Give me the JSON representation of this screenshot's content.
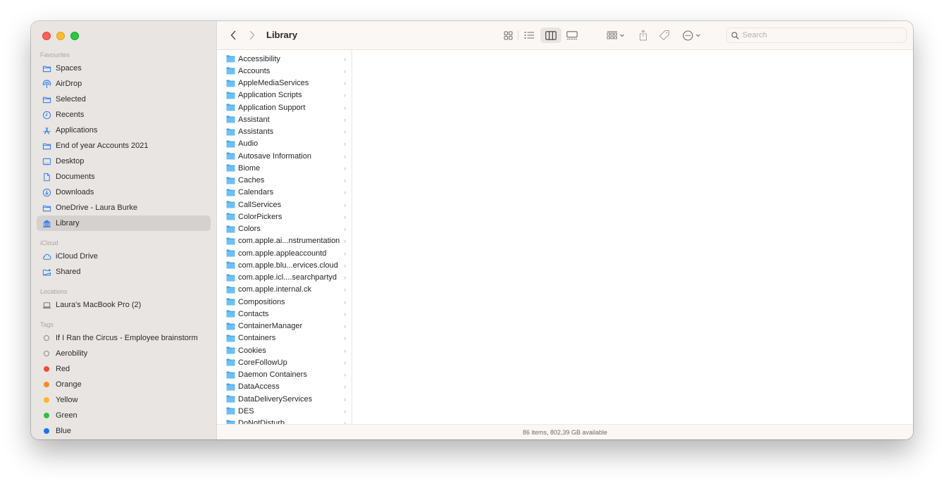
{
  "window": {
    "title": "Library"
  },
  "sidebar": {
    "sections": [
      {
        "label": "Favourites",
        "items": [
          {
            "label": "Spaces",
            "icon": "folder-icon"
          },
          {
            "label": "AirDrop",
            "icon": "airdrop-icon"
          },
          {
            "label": "Selected",
            "icon": "folder-icon"
          },
          {
            "label": "Recents",
            "icon": "clock-icon"
          },
          {
            "label": "Applications",
            "icon": "applications-icon"
          },
          {
            "label": "End of year Accounts 2021",
            "icon": "folder-icon"
          },
          {
            "label": "Desktop",
            "icon": "desktop-icon"
          },
          {
            "label": "Documents",
            "icon": "document-icon"
          },
          {
            "label": "Downloads",
            "icon": "download-icon"
          },
          {
            "label": "OneDrive - Laura Burke",
            "icon": "folder-icon"
          },
          {
            "label": "Library",
            "icon": "library-icon",
            "selected": true
          }
        ]
      },
      {
        "label": "iCloud",
        "items": [
          {
            "label": "iCloud Drive",
            "icon": "cloud-icon"
          },
          {
            "label": "Shared",
            "icon": "shared-folder-icon"
          }
        ]
      },
      {
        "label": "Locations",
        "items": [
          {
            "label": "Laura's MacBook Pro (2)",
            "icon": "laptop-icon"
          }
        ]
      },
      {
        "label": "Tags",
        "items": [
          {
            "label": "If I Ran the Circus - Employee brainstorm",
            "color": ""
          },
          {
            "label": "Aerobility",
            "color": ""
          },
          {
            "label": "Red",
            "color": "#f5483f"
          },
          {
            "label": "Orange",
            "color": "#f78b2c"
          },
          {
            "label": "Yellow",
            "color": "#fbb827"
          },
          {
            "label": "Green",
            "color": "#2cc23e"
          },
          {
            "label": "Blue",
            "color": "#1a73f0"
          }
        ]
      }
    ]
  },
  "toolbar": {
    "back_icon": "chevron-left-icon",
    "forward_icon": "chevron-right-icon",
    "view_modes": [
      "icon-view",
      "list-view",
      "column-view",
      "gallery-view"
    ],
    "active_view": "column-view",
    "group_icon": "group-icon",
    "share_icon": "share-icon",
    "tag_icon": "tag-icon",
    "more_icon": "ellipsis-circle-icon",
    "search_placeholder": "Search",
    "search_value": ""
  },
  "column": {
    "items": [
      "Accessibility",
      "Accounts",
      "AppleMediaServices",
      "Application Scripts",
      "Application Support",
      "Assistant",
      "Assistants",
      "Audio",
      "Autosave Information",
      "Biome",
      "Caches",
      "Calendars",
      "CallServices",
      "ColorPickers",
      "Colors",
      "com.apple.ai...nstrumentation",
      "com.apple.appleaccountd",
      "com.apple.blu...ervices.cloud",
      "com.apple.icl....searchpartyd",
      "com.apple.internal.ck",
      "Compositions",
      "Contacts",
      "ContainerManager",
      "Containers",
      "Cookies",
      "CoreFollowUp",
      "Daemon Containers",
      "DataAccess",
      "DataDeliveryServices",
      "DES",
      "DoNotDisturb"
    ]
  },
  "statusbar": {
    "text": "86 items, 802,39 GB available"
  },
  "colors": {
    "accent": "#2f7cf6",
    "sidebar_bg": "#e9e5e2",
    "toolbar_bg": "#fbf7f4",
    "folder": "#5bb5f0"
  }
}
